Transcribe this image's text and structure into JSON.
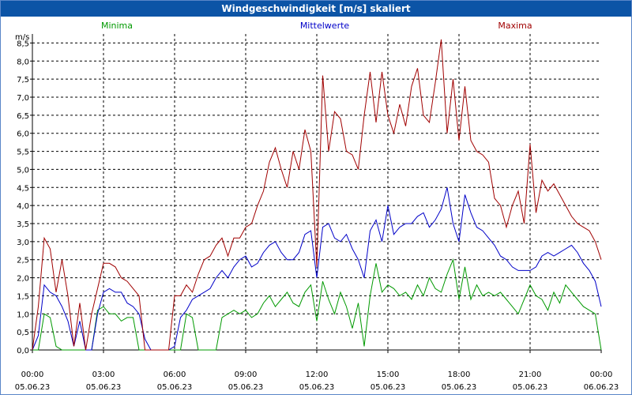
{
  "window": {
    "title": "Windgeschwindigkeit [m/s] skaliert"
  },
  "chart_data": {
    "type": "line",
    "title": "Windgeschwindigkeit [m/s] skaliert",
    "ylabel": "m/s",
    "xlabel": "",
    "ylim": [
      0,
      8.75
    ],
    "xlim": [
      0,
      24
    ],
    "grid": true,
    "legend_position": "top",
    "yticks": [
      "0,0",
      "0,5",
      "1,0",
      "1,5",
      "2,0",
      "2,5",
      "3,0",
      "3,5",
      "4,0",
      "4,5",
      "5,0",
      "5,5",
      "6,0",
      "6,5",
      "7,0",
      "7,5",
      "8,0",
      "8,5"
    ],
    "xticks": [
      {
        "time": "00:00",
        "date": "05.06.23"
      },
      {
        "time": "03:00",
        "date": "05.06.23"
      },
      {
        "time": "06:00",
        "date": "05.06.23"
      },
      {
        "time": "09:00",
        "date": "05.06.23"
      },
      {
        "time": "12:00",
        "date": "05.06.23"
      },
      {
        "time": "15:00",
        "date": "05.06.23"
      },
      {
        "time": "18:00",
        "date": "05.06.23"
      },
      {
        "time": "21:00",
        "date": "05.06.23"
      },
      {
        "time": "00:00",
        "date": "06.06.23"
      }
    ],
    "series": [
      {
        "name": "Minima",
        "color": "#009900",
        "x": [
          0,
          0.25,
          0.5,
          0.75,
          1.0,
          1.25,
          1.5,
          1.75,
          2.0,
          2.25,
          2.5,
          2.75,
          3.0,
          3.25,
          3.5,
          3.75,
          4.0,
          4.25,
          4.5,
          4.75,
          5.0,
          5.25,
          5.5,
          5.75,
          6.0,
          6.25,
          6.5,
          6.75,
          7.0,
          7.25,
          7.5,
          7.75,
          8.0,
          8.25,
          8.5,
          8.75,
          9.0,
          9.25,
          9.5,
          9.75,
          10.0,
          10.25,
          10.5,
          10.75,
          11.0,
          11.25,
          11.5,
          11.75,
          12.0,
          12.25,
          12.5,
          12.75,
          13.0,
          13.25,
          13.5,
          13.75,
          14.0,
          14.25,
          14.5,
          14.75,
          15.0,
          15.25,
          15.5,
          15.75,
          16.0,
          16.25,
          16.5,
          16.75,
          17.0,
          17.25,
          17.5,
          17.75,
          18.0,
          18.25,
          18.5,
          18.75,
          19.0,
          19.25,
          19.5,
          19.75,
          20.0,
          20.25,
          20.5,
          20.75,
          21.0,
          21.25,
          21.5,
          21.75,
          22.0,
          22.25,
          22.5,
          22.75,
          23.0,
          23.25,
          23.5,
          23.75,
          24.0
        ],
        "values": [
          0,
          0,
          1.0,
          0.9,
          0.1,
          0,
          0,
          0,
          0,
          0,
          0,
          1.1,
          1.2,
          1.0,
          1.0,
          0.8,
          0.9,
          0.9,
          0,
          0,
          0,
          0,
          0,
          0,
          0,
          0,
          1.0,
          0.9,
          0,
          0,
          0,
          0,
          0.9,
          1.0,
          1.1,
          1.0,
          1.1,
          0.9,
          1.0,
          1.3,
          1.5,
          1.2,
          1.4,
          1.6,
          1.3,
          1.2,
          1.6,
          1.8,
          0.8,
          1.9,
          1.4,
          1.0,
          1.6,
          1.2,
          0.6,
          1.3,
          0.1,
          1.5,
          2.4,
          1.6,
          1.8,
          1.7,
          1.5,
          1.6,
          1.4,
          1.8,
          1.5,
          2.0,
          1.7,
          1.6,
          2.1,
          2.5,
          1.4,
          2.3,
          1.4,
          1.8,
          1.5,
          1.6,
          1.5,
          1.6,
          1.4,
          1.2,
          1.0,
          1.4,
          1.8,
          1.5,
          1.4,
          1.1,
          1.6,
          1.3,
          1.8,
          1.6,
          1.4,
          1.2,
          1.1,
          1.0,
          0
        ]
      },
      {
        "name": "Mittelwerte",
        "color": "#0000c8",
        "x": [
          0,
          0.25,
          0.5,
          0.75,
          1.0,
          1.25,
          1.5,
          1.75,
          2.0,
          2.25,
          2.5,
          2.75,
          3.0,
          3.25,
          3.5,
          3.75,
          4.0,
          4.25,
          4.5,
          4.75,
          5.0,
          5.25,
          5.5,
          5.75,
          6.0,
          6.25,
          6.5,
          6.75,
          7.0,
          7.25,
          7.5,
          7.75,
          8.0,
          8.25,
          8.5,
          8.75,
          9.0,
          9.25,
          9.5,
          9.75,
          10.0,
          10.25,
          10.5,
          10.75,
          11.0,
          11.25,
          11.5,
          11.75,
          12.0,
          12.25,
          12.5,
          12.75,
          13.0,
          13.25,
          13.5,
          13.75,
          14.0,
          14.25,
          14.5,
          14.75,
          15.0,
          15.25,
          15.5,
          15.75,
          16.0,
          16.25,
          16.5,
          16.75,
          17.0,
          17.25,
          17.5,
          17.75,
          18.0,
          18.25,
          18.5,
          18.75,
          19.0,
          19.25,
          19.5,
          19.75,
          20.0,
          20.25,
          20.5,
          20.75,
          21.0,
          21.25,
          21.5,
          21.75,
          22.0,
          22.25,
          22.5,
          22.75,
          23.0,
          23.25,
          23.5,
          23.75,
          24.0
        ],
        "values": [
          0,
          0.4,
          1.8,
          1.6,
          1.5,
          1.2,
          0.8,
          0.1,
          0.8,
          0,
          0,
          1.0,
          1.6,
          1.7,
          1.6,
          1.6,
          1.3,
          1.2,
          1.0,
          0.3,
          0,
          0,
          0,
          0,
          0.1,
          0.9,
          1.1,
          1.4,
          1.5,
          1.6,
          1.7,
          2.0,
          2.2,
          2.0,
          2.3,
          2.5,
          2.6,
          2.3,
          2.4,
          2.7,
          2.9,
          3.0,
          2.7,
          2.5,
          2.5,
          2.7,
          3.2,
          3.3,
          2.0,
          3.4,
          3.5,
          3.1,
          3.0,
          3.2,
          2.8,
          2.5,
          2.0,
          3.3,
          3.6,
          3.0,
          4.0,
          3.2,
          3.4,
          3.5,
          3.5,
          3.7,
          3.8,
          3.4,
          3.6,
          3.9,
          4.5,
          3.5,
          3.0,
          4.3,
          3.8,
          3.4,
          3.3,
          3.1,
          2.9,
          2.6,
          2.5,
          2.3,
          2.2,
          2.2,
          2.2,
          2.3,
          2.6,
          2.7,
          2.6,
          2.7,
          2.8,
          2.9,
          2.7,
          2.4,
          2.2,
          1.9,
          1.2
        ]
      },
      {
        "name": "Maxima",
        "color": "#a00000",
        "x": [
          0,
          0.25,
          0.5,
          0.75,
          1.0,
          1.25,
          1.5,
          1.75,
          2.0,
          2.25,
          2.5,
          2.75,
          3.0,
          3.25,
          3.5,
          3.75,
          4.0,
          4.25,
          4.5,
          4.75,
          5.0,
          5.25,
          5.5,
          5.75,
          6.0,
          6.25,
          6.5,
          6.75,
          7.0,
          7.25,
          7.5,
          7.75,
          8.0,
          8.25,
          8.5,
          8.75,
          9.0,
          9.25,
          9.5,
          9.75,
          10.0,
          10.25,
          10.5,
          10.75,
          11.0,
          11.25,
          11.5,
          11.75,
          12.0,
          12.25,
          12.5,
          12.75,
          13.0,
          13.25,
          13.5,
          13.75,
          14.0,
          14.25,
          14.5,
          14.75,
          15.0,
          15.25,
          15.5,
          15.75,
          16.0,
          16.25,
          16.5,
          16.75,
          17.0,
          17.25,
          17.5,
          17.75,
          18.0,
          18.25,
          18.5,
          18.75,
          19.0,
          19.25,
          19.5,
          19.75,
          20.0,
          20.25,
          20.5,
          20.75,
          21.0,
          21.25,
          21.5,
          21.75,
          22.0,
          22.25,
          22.5,
          22.75,
          23.0,
          23.25,
          23.5,
          23.75,
          24.0
        ],
        "values": [
          0,
          1.2,
          3.1,
          2.8,
          1.6,
          2.5,
          1.5,
          0.1,
          1.3,
          0,
          1.0,
          1.7,
          2.4,
          2.4,
          2.3,
          2.0,
          1.9,
          1.7,
          1.5,
          0,
          0,
          0,
          0,
          0,
          1.5,
          1.5,
          1.8,
          1.6,
          2.1,
          2.5,
          2.6,
          2.9,
          3.1,
          2.6,
          3.1,
          3.1,
          3.4,
          3.5,
          4.0,
          4.4,
          5.2,
          5.6,
          5.0,
          4.5,
          5.5,
          5.0,
          6.1,
          5.5,
          2.3,
          7.6,
          5.5,
          6.6,
          6.4,
          5.5,
          5.4,
          5.0,
          6.5,
          7.7,
          6.3,
          7.7,
          6.5,
          6.0,
          6.8,
          6.2,
          7.3,
          7.8,
          6.5,
          6.3,
          7.4,
          8.6,
          6.0,
          7.5,
          5.8,
          7.3,
          5.8,
          5.5,
          5.4,
          5.2,
          4.2,
          4.0,
          3.4,
          4.0,
          4.4,
          3.5,
          5.7,
          3.8,
          4.7,
          4.4,
          4.6,
          4.3,
          4.0,
          3.7,
          3.5,
          3.4,
          3.3,
          3.0,
          2.5
        ]
      }
    ]
  }
}
